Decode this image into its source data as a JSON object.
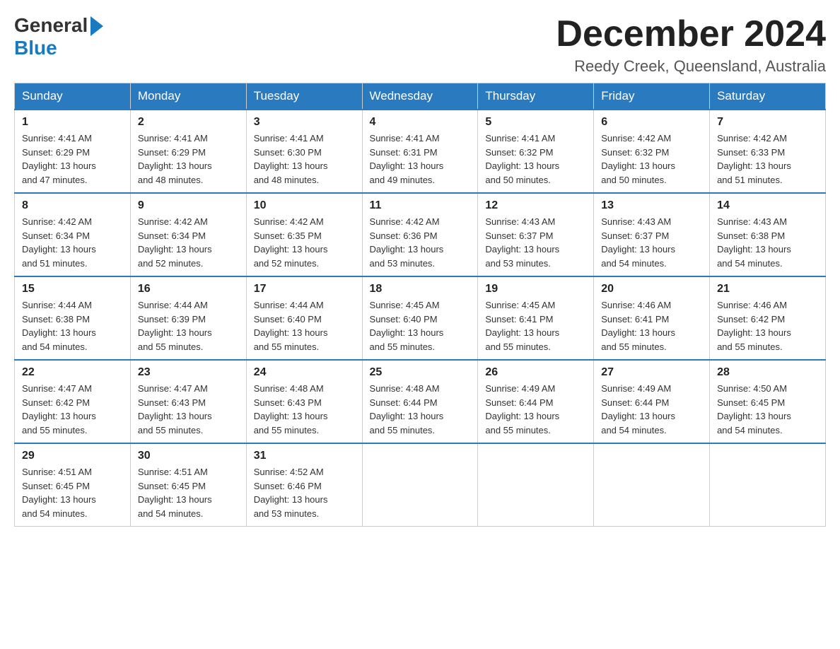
{
  "header": {
    "logo_general": "General",
    "logo_blue": "Blue",
    "month_title": "December 2024",
    "location": "Reedy Creek, Queensland, Australia"
  },
  "weekdays": [
    "Sunday",
    "Monday",
    "Tuesday",
    "Wednesday",
    "Thursday",
    "Friday",
    "Saturday"
  ],
  "weeks": [
    [
      {
        "day": "1",
        "sunrise": "4:41 AM",
        "sunset": "6:29 PM",
        "daylight": "13 hours and 47 minutes."
      },
      {
        "day": "2",
        "sunrise": "4:41 AM",
        "sunset": "6:29 PM",
        "daylight": "13 hours and 48 minutes."
      },
      {
        "day": "3",
        "sunrise": "4:41 AM",
        "sunset": "6:30 PM",
        "daylight": "13 hours and 48 minutes."
      },
      {
        "day": "4",
        "sunrise": "4:41 AM",
        "sunset": "6:31 PM",
        "daylight": "13 hours and 49 minutes."
      },
      {
        "day": "5",
        "sunrise": "4:41 AM",
        "sunset": "6:32 PM",
        "daylight": "13 hours and 50 minutes."
      },
      {
        "day": "6",
        "sunrise": "4:42 AM",
        "sunset": "6:32 PM",
        "daylight": "13 hours and 50 minutes."
      },
      {
        "day": "7",
        "sunrise": "4:42 AM",
        "sunset": "6:33 PM",
        "daylight": "13 hours and 51 minutes."
      }
    ],
    [
      {
        "day": "8",
        "sunrise": "4:42 AM",
        "sunset": "6:34 PM",
        "daylight": "13 hours and 51 minutes."
      },
      {
        "day": "9",
        "sunrise": "4:42 AM",
        "sunset": "6:34 PM",
        "daylight": "13 hours and 52 minutes."
      },
      {
        "day": "10",
        "sunrise": "4:42 AM",
        "sunset": "6:35 PM",
        "daylight": "13 hours and 52 minutes."
      },
      {
        "day": "11",
        "sunrise": "4:42 AM",
        "sunset": "6:36 PM",
        "daylight": "13 hours and 53 minutes."
      },
      {
        "day": "12",
        "sunrise": "4:43 AM",
        "sunset": "6:37 PM",
        "daylight": "13 hours and 53 minutes."
      },
      {
        "day": "13",
        "sunrise": "4:43 AM",
        "sunset": "6:37 PM",
        "daylight": "13 hours and 54 minutes."
      },
      {
        "day": "14",
        "sunrise": "4:43 AM",
        "sunset": "6:38 PM",
        "daylight": "13 hours and 54 minutes."
      }
    ],
    [
      {
        "day": "15",
        "sunrise": "4:44 AM",
        "sunset": "6:38 PM",
        "daylight": "13 hours and 54 minutes."
      },
      {
        "day": "16",
        "sunrise": "4:44 AM",
        "sunset": "6:39 PM",
        "daylight": "13 hours and 55 minutes."
      },
      {
        "day": "17",
        "sunrise": "4:44 AM",
        "sunset": "6:40 PM",
        "daylight": "13 hours and 55 minutes."
      },
      {
        "day": "18",
        "sunrise": "4:45 AM",
        "sunset": "6:40 PM",
        "daylight": "13 hours and 55 minutes."
      },
      {
        "day": "19",
        "sunrise": "4:45 AM",
        "sunset": "6:41 PM",
        "daylight": "13 hours and 55 minutes."
      },
      {
        "day": "20",
        "sunrise": "4:46 AM",
        "sunset": "6:41 PM",
        "daylight": "13 hours and 55 minutes."
      },
      {
        "day": "21",
        "sunrise": "4:46 AM",
        "sunset": "6:42 PM",
        "daylight": "13 hours and 55 minutes."
      }
    ],
    [
      {
        "day": "22",
        "sunrise": "4:47 AM",
        "sunset": "6:42 PM",
        "daylight": "13 hours and 55 minutes."
      },
      {
        "day": "23",
        "sunrise": "4:47 AM",
        "sunset": "6:43 PM",
        "daylight": "13 hours and 55 minutes."
      },
      {
        "day": "24",
        "sunrise": "4:48 AM",
        "sunset": "6:43 PM",
        "daylight": "13 hours and 55 minutes."
      },
      {
        "day": "25",
        "sunrise": "4:48 AM",
        "sunset": "6:44 PM",
        "daylight": "13 hours and 55 minutes."
      },
      {
        "day": "26",
        "sunrise": "4:49 AM",
        "sunset": "6:44 PM",
        "daylight": "13 hours and 55 minutes."
      },
      {
        "day": "27",
        "sunrise": "4:49 AM",
        "sunset": "6:44 PM",
        "daylight": "13 hours and 54 minutes."
      },
      {
        "day": "28",
        "sunrise": "4:50 AM",
        "sunset": "6:45 PM",
        "daylight": "13 hours and 54 minutes."
      }
    ],
    [
      {
        "day": "29",
        "sunrise": "4:51 AM",
        "sunset": "6:45 PM",
        "daylight": "13 hours and 54 minutes."
      },
      {
        "day": "30",
        "sunrise": "4:51 AM",
        "sunset": "6:45 PM",
        "daylight": "13 hours and 54 minutes."
      },
      {
        "day": "31",
        "sunrise": "4:52 AM",
        "sunset": "6:46 PM",
        "daylight": "13 hours and 53 minutes."
      },
      null,
      null,
      null,
      null
    ]
  ]
}
